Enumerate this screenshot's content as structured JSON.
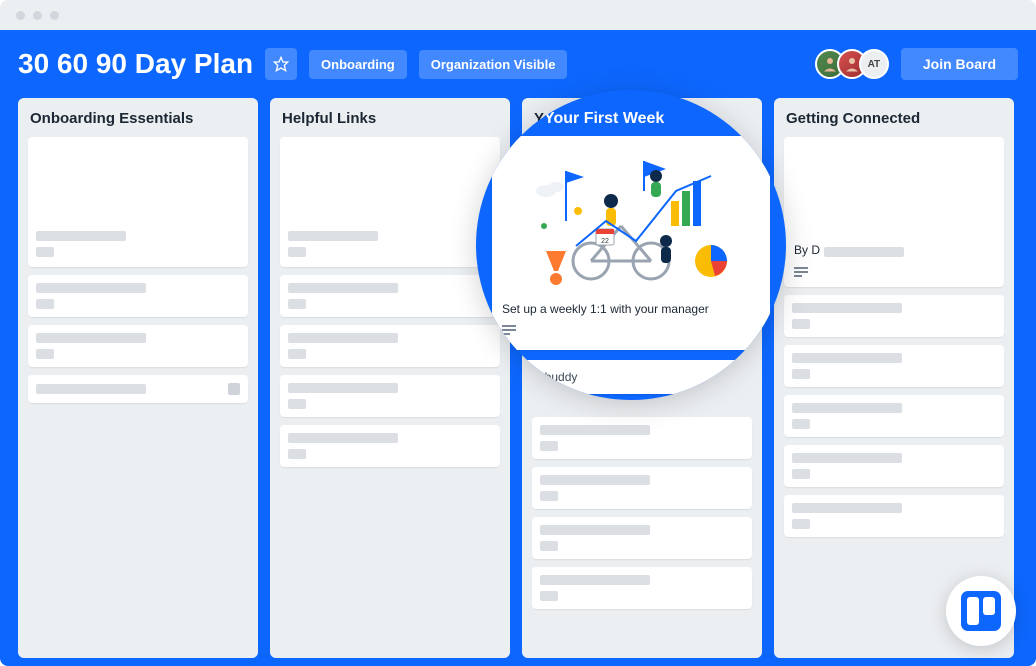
{
  "header": {
    "board_title": "30 60 90 Day Plan",
    "tag_onboarding": "Onboarding",
    "tag_visibility": "Organization Visible",
    "avatar3_initials": "AT",
    "join_label": "Join Board"
  },
  "lists": [
    {
      "title": "Onboarding Essentials"
    },
    {
      "title": "Helpful Links"
    },
    {
      "title": "Your First Week",
      "cards": [
        {
          "title": "Set up a weekly 1:1 with your manager"
        },
        {
          "title": "Make a buddy"
        }
      ]
    },
    {
      "title": "Getting Connected",
      "cards": [
        {
          "title_prefix": "By D"
        }
      ]
    }
  ]
}
